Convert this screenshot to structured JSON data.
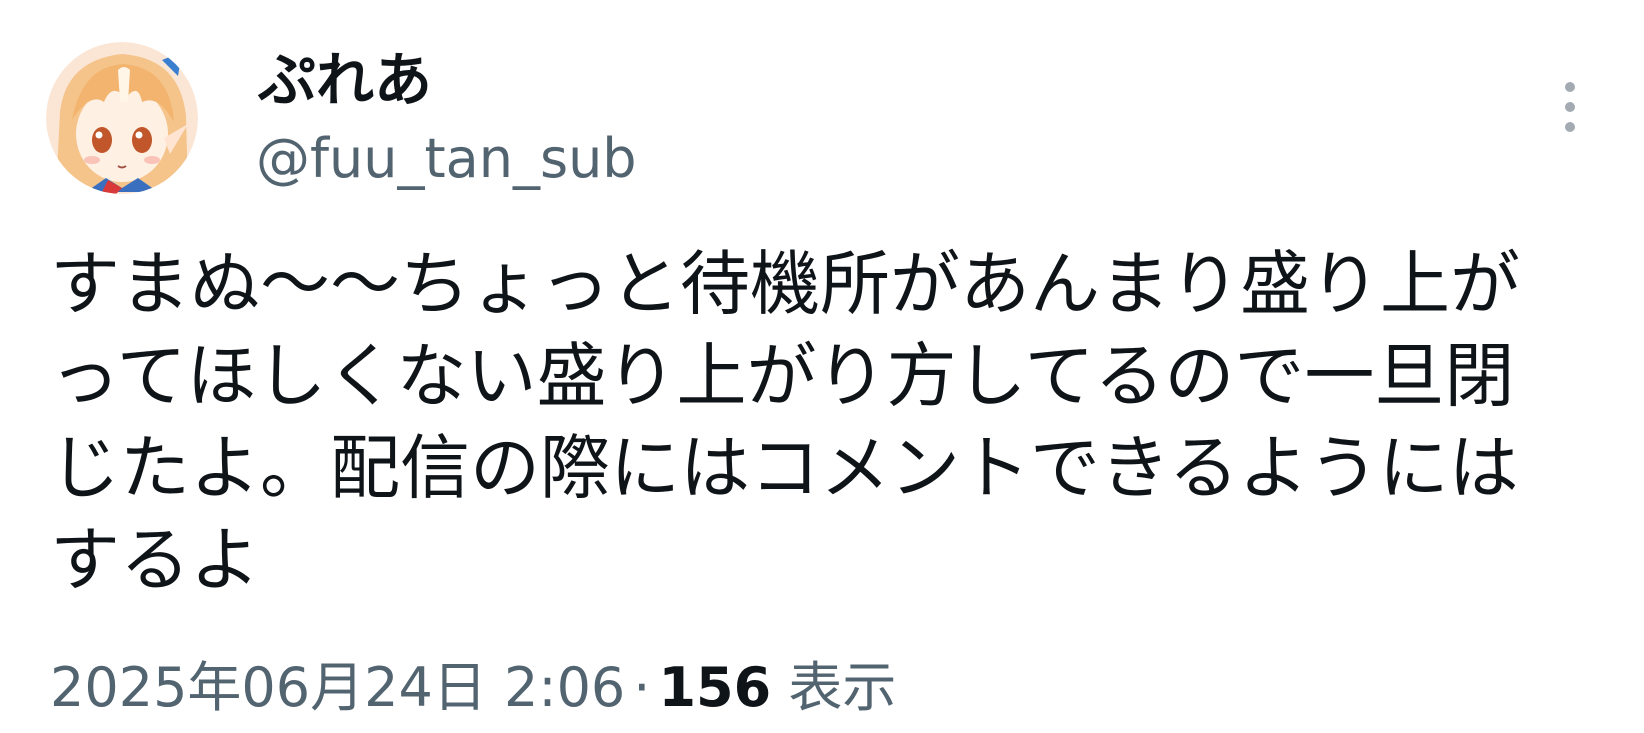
{
  "tweet": {
    "author": {
      "display_name": "ぷれあ",
      "handle": "@fuu_tan_sub",
      "avatar_icon": "anime-character-avatar"
    },
    "more_icon": "more-vertical-icon",
    "text": "すまぬ〜〜ちょっと待機所があんまり盛り上がってほしくない盛り上がり方してるので一旦閉じたよ。配信の際にはコメントできるようにはするよ",
    "timestamp": "2025年06月24日 2:06",
    "separator": "·",
    "views_count": "156",
    "views_label": "表示"
  },
  "colors": {
    "text_primary": "#0f1419",
    "text_secondary": "#536471",
    "background": "#ffffff"
  }
}
